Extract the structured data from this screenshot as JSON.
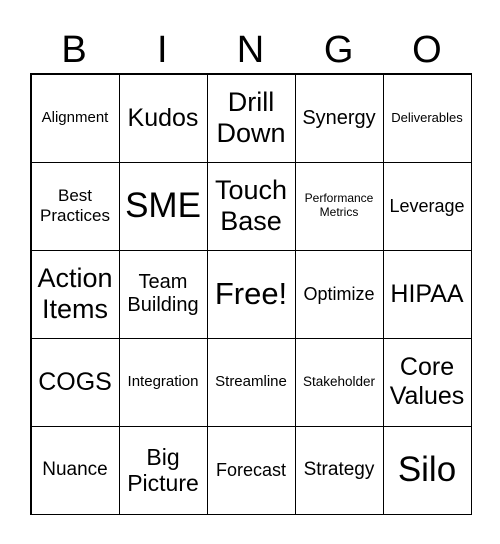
{
  "header": [
    "B",
    "I",
    "N",
    "G",
    "O"
  ],
  "cells": [
    [
      "Alignment",
      "Kudos",
      "Drill Down",
      "Synergy",
      "Deliverables"
    ],
    [
      "Best Practices",
      "SME",
      "Touch Base",
      "Performance Metrics",
      "Leverage"
    ],
    [
      "Action Items",
      "Team Building",
      "Free!",
      "Optimize",
      "HIPAA"
    ],
    [
      "COGS",
      "Integration",
      "Streamline",
      "Stakeholder",
      "Core Values"
    ],
    [
      "Nuance",
      "Big Picture",
      "Forecast",
      "Strategy",
      "Silo"
    ]
  ]
}
